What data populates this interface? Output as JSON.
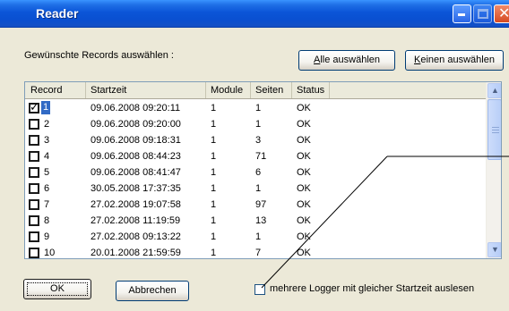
{
  "window": {
    "title": "Reader"
  },
  "prompt": "Gewünschte Records auswählen :",
  "buttons": {
    "select_all": {
      "mnemonic": "A",
      "rest": "lle auswählen"
    },
    "select_none": {
      "mnemonic": "K",
      "rest": "einen auswählen"
    },
    "ok": "OK",
    "cancel": "Abbrechen"
  },
  "table": {
    "columns": [
      "Record",
      "Startzeit",
      "Module",
      "Seiten",
      "Status"
    ],
    "rows": [
      {
        "checked": true,
        "record": "1",
        "startzeit": "09.06.2008 09:20:11",
        "module": "1",
        "seiten": "1",
        "status": "OK"
      },
      {
        "checked": false,
        "record": "2",
        "startzeit": "09.06.2008 09:20:00",
        "module": "1",
        "seiten": "1",
        "status": "OK"
      },
      {
        "checked": false,
        "record": "3",
        "startzeit": "09.06.2008 09:18:31",
        "module": "1",
        "seiten": "3",
        "status": "OK"
      },
      {
        "checked": false,
        "record": "4",
        "startzeit": "09.06.2008 08:44:23",
        "module": "1",
        "seiten": "71",
        "status": "OK"
      },
      {
        "checked": false,
        "record": "5",
        "startzeit": "09.06.2008 08:41:47",
        "module": "1",
        "seiten": "6",
        "status": "OK"
      },
      {
        "checked": false,
        "record": "6",
        "startzeit": "30.05.2008 17:37:35",
        "module": "1",
        "seiten": "1",
        "status": "OK"
      },
      {
        "checked": false,
        "record": "7",
        "startzeit": "27.02.2008 19:07:58",
        "module": "1",
        "seiten": "97",
        "status": "OK"
      },
      {
        "checked": false,
        "record": "8",
        "startzeit": "27.02.2008 11:19:59",
        "module": "1",
        "seiten": "13",
        "status": "OK"
      },
      {
        "checked": false,
        "record": "9",
        "startzeit": "27.02.2008 09:13:22",
        "module": "1",
        "seiten": "1",
        "status": "OK"
      },
      {
        "checked": false,
        "record": "10",
        "startzeit": "20.01.2008 21:59:59",
        "module": "1",
        "seiten": "7",
        "status": "OK"
      }
    ]
  },
  "option": {
    "checked": false,
    "label": "mehrere Logger mit gleicher Startzeit auslesen"
  },
  "icons": {
    "minimize": "minimize-icon",
    "maximize": "maximize-icon",
    "close": "close-icon",
    "scroll_up": "chevron-up-icon",
    "scroll_down": "chevron-down-icon"
  }
}
